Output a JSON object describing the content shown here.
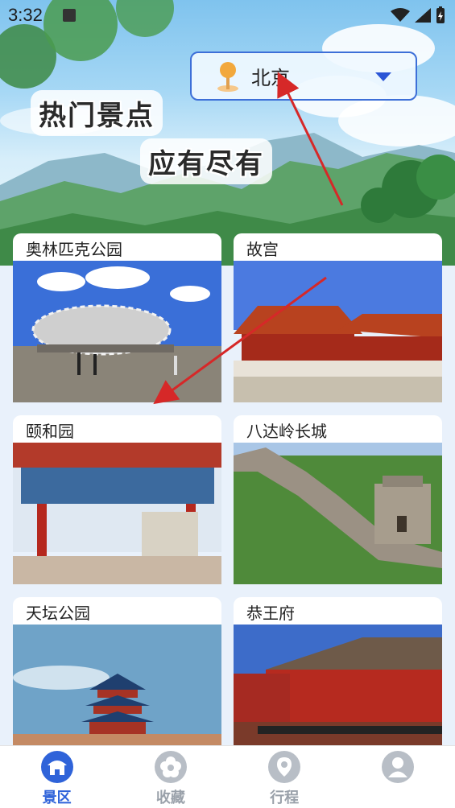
{
  "status_bar": {
    "time": "3:32"
  },
  "city_selector": {
    "value": "北京"
  },
  "banner": {
    "slogan_1": "热门景点",
    "slogan_2": "应有尽有"
  },
  "attractions": [
    {
      "name": "奥林匹克公园"
    },
    {
      "name": "故宫"
    },
    {
      "name": "颐和园"
    },
    {
      "name": "八达岭长城"
    },
    {
      "name": "天坛公园"
    },
    {
      "name": "恭王府"
    }
  ],
  "tabs": [
    {
      "label": "景区",
      "icon": "scenic-spot-icon",
      "active": true
    },
    {
      "label": "收藏",
      "icon": "favorite-flower-icon",
      "active": false
    },
    {
      "label": "行程",
      "icon": "itinerary-pin-icon",
      "active": false
    },
    {
      "label": "",
      "icon": "profile-icon",
      "active": false
    }
  ],
  "colors": {
    "accent": "#2f63d9",
    "tab_inactive": "#b8bec6",
    "annotation_arrow": "#d62828"
  }
}
